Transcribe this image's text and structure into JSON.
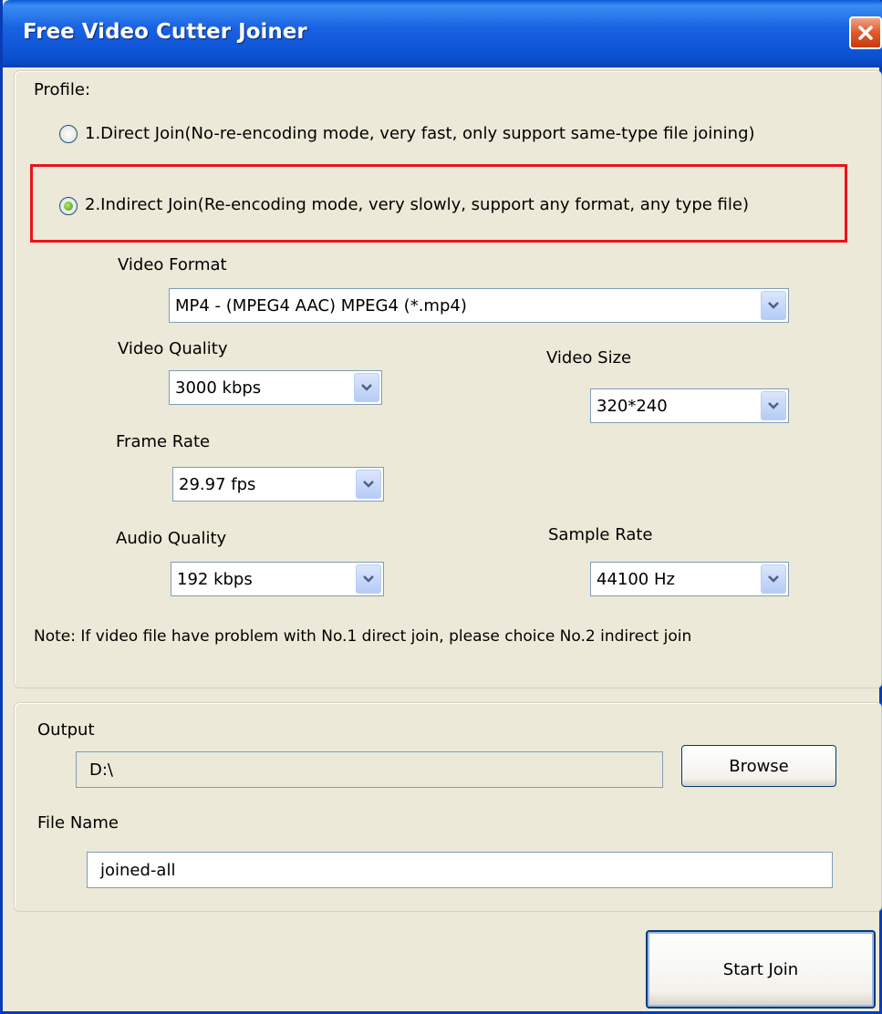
{
  "window": {
    "title": "Free Video Cutter Joiner"
  },
  "profile": {
    "label": "Profile:",
    "options": [
      {
        "label": "1.Direct Join(No-re-encoding mode, very fast, only support same-type file joining)",
        "selected": false
      },
      {
        "label": "2.Indirect Join(Re-encoding mode, very slowly, support any format, any type file)",
        "selected": true
      }
    ]
  },
  "settings": {
    "video_format": {
      "label": "Video Format",
      "value": "MP4 - (MPEG4 AAC) MPEG4 (*.mp4)"
    },
    "video_quality": {
      "label": "Video Quality",
      "value": "3000 kbps"
    },
    "video_size": {
      "label": "Video Size",
      "value": "320*240"
    },
    "frame_rate": {
      "label": "Frame Rate",
      "value": "29.97 fps"
    },
    "audio_quality": {
      "label": "Audio Quality",
      "value": "192 kbps"
    },
    "sample_rate": {
      "label": "Sample Rate",
      "value": "44100 Hz"
    },
    "note": "Note: If video file have problem with No.1 direct join, please choice No.2 indirect join"
  },
  "output": {
    "label": "Output",
    "path": "D:\\",
    "browse_label": "Browse",
    "file_name_label": "File Name",
    "file_name": "joined-all"
  },
  "actions": {
    "start_label": "Start Join"
  },
  "colors": {
    "titlebar": "#0a5bd8",
    "highlight": "#e8141c",
    "window_bg": "#ece9d8"
  },
  "icons": {
    "close": "close-icon",
    "dropdown": "chevron-down-icon"
  }
}
